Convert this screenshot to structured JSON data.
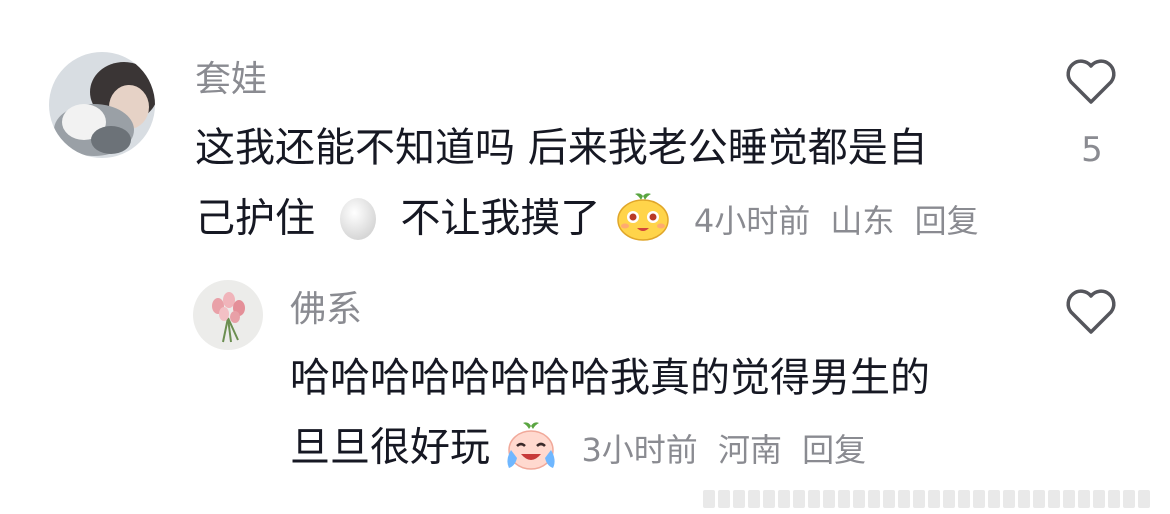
{
  "comments": [
    {
      "username": "套娃",
      "text_line1": "这我还能不知道吗 后来我老公睡觉都是自",
      "text_line2_a": "己护住",
      "text_line2_b": "不让我摸了",
      "time": "4小时前",
      "location": "山东",
      "reply_label": "回复",
      "like_count": "5",
      "emoji_1": "egg-emoji",
      "emoji_2": "cute-smile-emoji"
    },
    {
      "username": "佛系",
      "text_line1": "哈哈哈哈哈哈哈哈我真的觉得男生的",
      "text_line2": "旦旦很好玩",
      "time": "3小时前",
      "location": "河南",
      "reply_label": "回复",
      "emoji_1": "laugh-cry-emoji"
    }
  ],
  "colors": {
    "text": "#161823",
    "secondary": "#8a8b91"
  }
}
